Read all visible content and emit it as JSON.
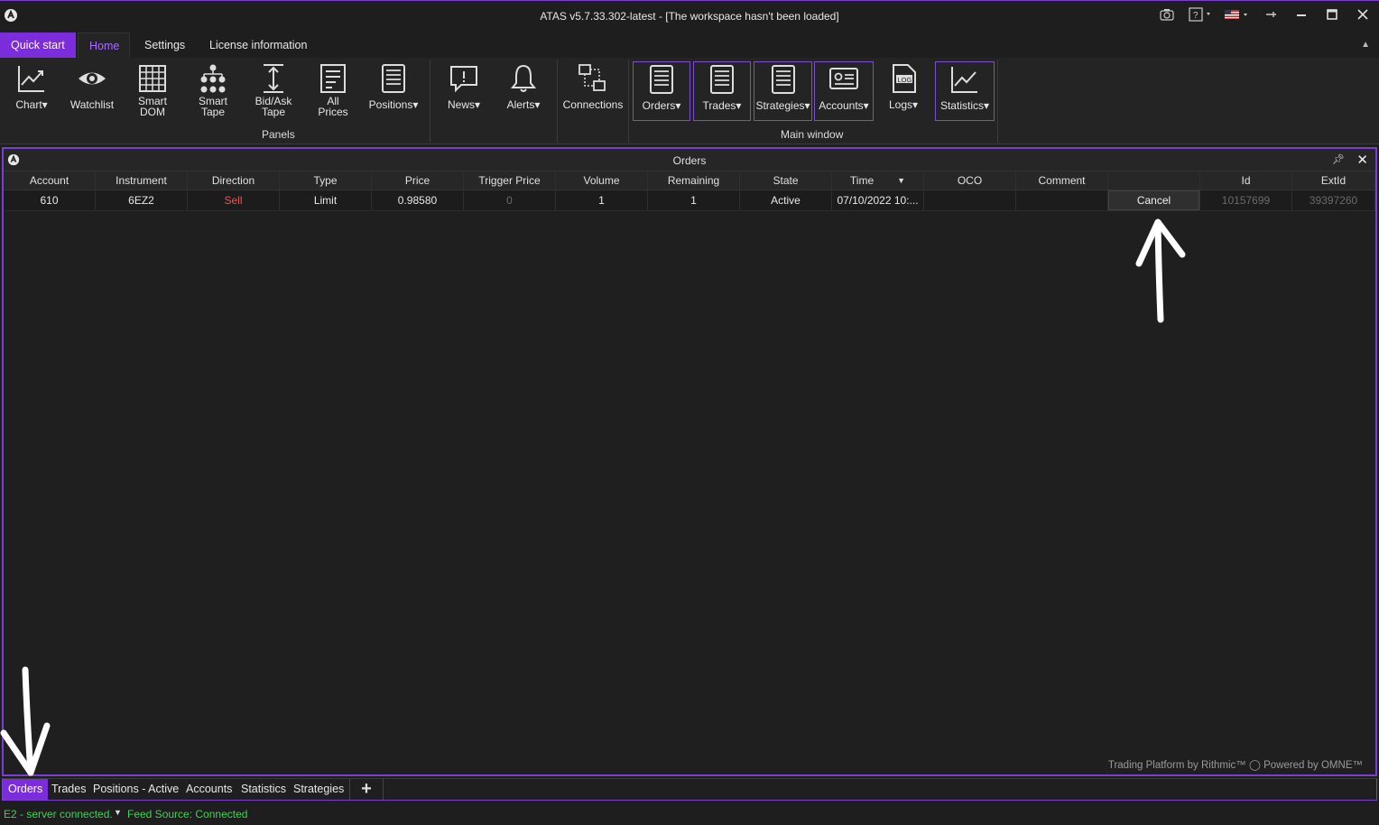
{
  "window": {
    "title": "ATAS v5.7.33.302-latest - [The workspace hasn't been loaded]"
  },
  "ribbon_tabs": [
    "Quick start",
    "Home",
    "Settings",
    "License information"
  ],
  "ribbon": {
    "buttons": [
      {
        "label": "Chart▾",
        "icon": "chart-icon"
      },
      {
        "label": "Watchlist",
        "icon": "eye-icon"
      },
      {
        "label": "Smart DOM",
        "icon": "grid-icon"
      },
      {
        "label": "Smart Tape",
        "icon": "tree-icon"
      },
      {
        "label": "Bid/Ask Tape",
        "icon": "vertical-arrows-icon"
      },
      {
        "label": "All Prices",
        "icon": "document-icon"
      },
      {
        "label": "Positions▾",
        "icon": "list-icon"
      },
      {
        "label": "News▾",
        "icon": "speech-bubble-icon"
      },
      {
        "label": "Alerts▾",
        "icon": "bell-icon"
      },
      {
        "label": "Connections",
        "icon": "network-icon"
      },
      {
        "label": "Orders▾",
        "icon": "list-icon"
      },
      {
        "label": "Trades▾",
        "icon": "list-icon"
      },
      {
        "label": "Strategies▾",
        "icon": "list-icon"
      },
      {
        "label": "Accounts▾",
        "icon": "card-icon"
      },
      {
        "label": "Logs▾",
        "icon": "log-icon"
      },
      {
        "label": "Statistics▾",
        "icon": "chart-icon"
      }
    ],
    "group_panels": "Panels",
    "group_main_window": "Main window"
  },
  "orders_panel": {
    "title": "Orders",
    "columns": [
      "Account",
      "Instrument",
      "Direction",
      "Type",
      "Price",
      "Trigger Price",
      "Volume",
      "Remaining",
      "State",
      "Time",
      "OCO",
      "Comment",
      "",
      "Id",
      "ExtId"
    ],
    "rows": [
      {
        "account": "610",
        "instrument": "6EZ2",
        "direction": "Sell",
        "type": "Limit",
        "price": "0.98580",
        "trigger_price": "0",
        "volume": "1",
        "remaining": "1",
        "state": "Active",
        "time": "07/10/2022 10:...",
        "oco": "",
        "comment": "",
        "action": "Cancel",
        "id": "10157699",
        "extid": "39397260"
      }
    ],
    "watermark": "Trading Platform by Rithmic™ ◯ Powered by OMNE™"
  },
  "bottom_tabs": [
    "Orders",
    "Trades",
    "Positions - Active",
    "Accounts",
    "Statistics",
    "Strategies"
  ],
  "add_tab": "+",
  "status": {
    "connection": "E2 - server connected.",
    "feed": "Feed Source: Connected"
  },
  "colors": {
    "accent": "#7b2ddb",
    "sell": "#e05a5a",
    "connected": "#3fd05a"
  }
}
